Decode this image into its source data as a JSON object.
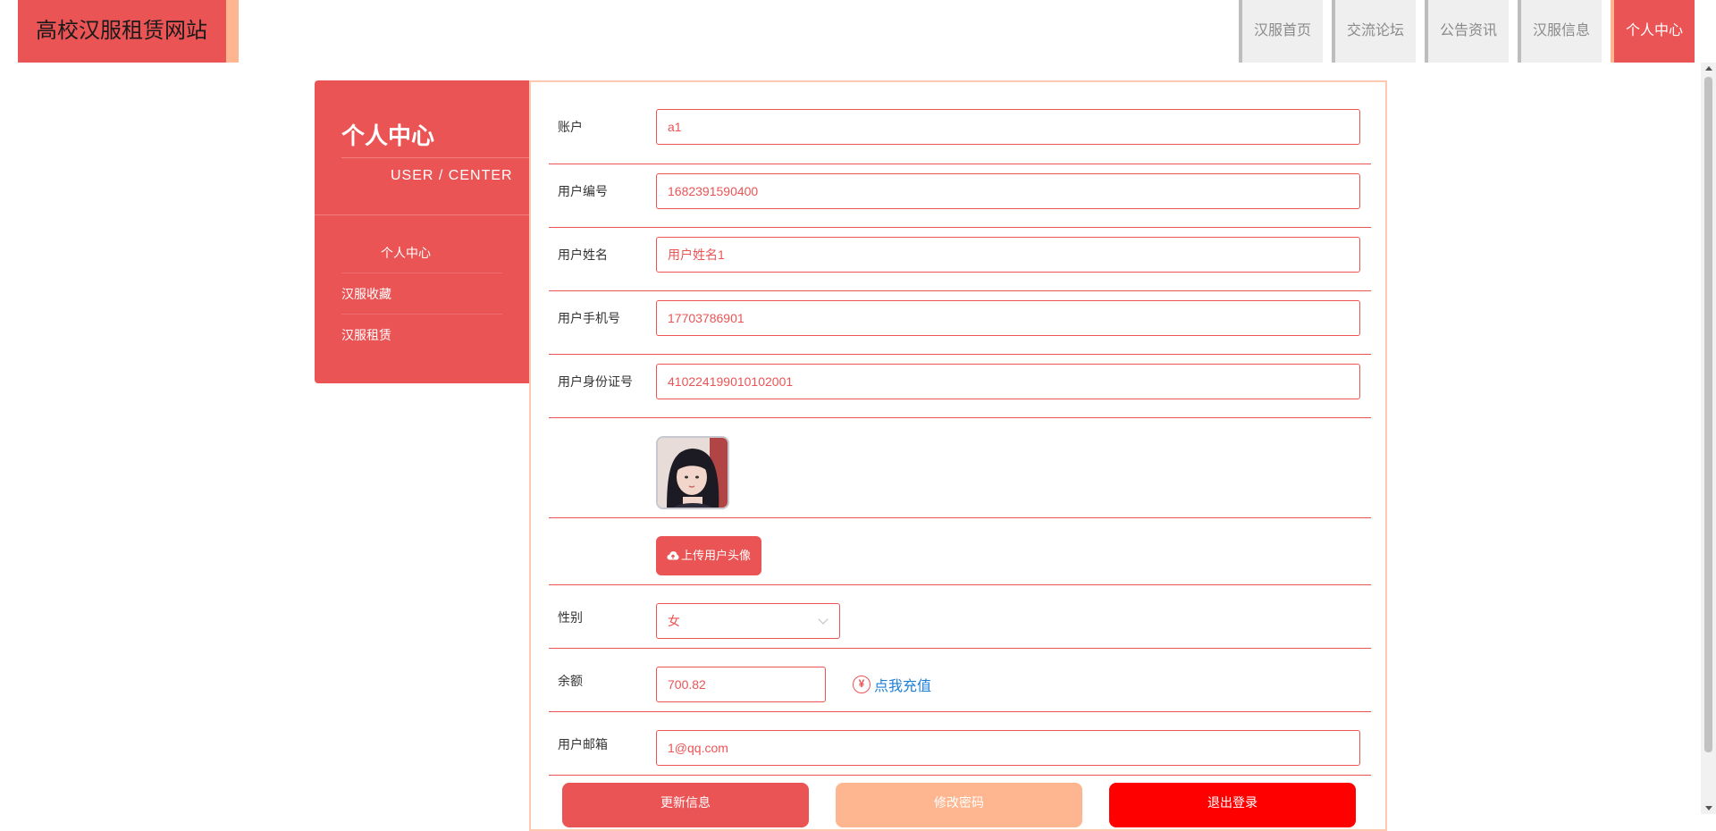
{
  "header": {
    "brand": "高校汉服租赁网站",
    "nav": [
      {
        "label": "汉服首页"
      },
      {
        "label": "交流论坛"
      },
      {
        "label": "公告资讯"
      },
      {
        "label": "汉服信息"
      },
      {
        "label": "个人中心"
      }
    ]
  },
  "sidebar": {
    "title": "个人中心",
    "subtitle": "USER / CENTER",
    "items": [
      {
        "label": "个人中心"
      },
      {
        "label": "汉服收藏"
      },
      {
        "label": "汉服租赁"
      }
    ]
  },
  "form": {
    "account": {
      "label": "账户",
      "value": "a1"
    },
    "user_no": {
      "label": "用户编号",
      "value": "1682391590400"
    },
    "user_name": {
      "label": "用户姓名",
      "value": "用户姓名1"
    },
    "phone": {
      "label": "用户手机号",
      "value": "17703786901"
    },
    "id_card": {
      "label": "用户身份证号",
      "value": "410224199010102001"
    },
    "upload_label": "上传用户头像",
    "gender": {
      "label": "性别",
      "value": "女"
    },
    "balance": {
      "label": "余额",
      "value": "700.82",
      "recharge": "点我充值"
    },
    "email": {
      "label": "用户邮箱",
      "value": "1@qq.com"
    }
  },
  "buttons": {
    "update": "更新信息",
    "password": "修改密码",
    "logout": "退出登录"
  },
  "colors": {
    "primary": "#EA5455",
    "accent": "#FDB68F",
    "danger": "#FF0000",
    "link": "#1E7FD8"
  }
}
